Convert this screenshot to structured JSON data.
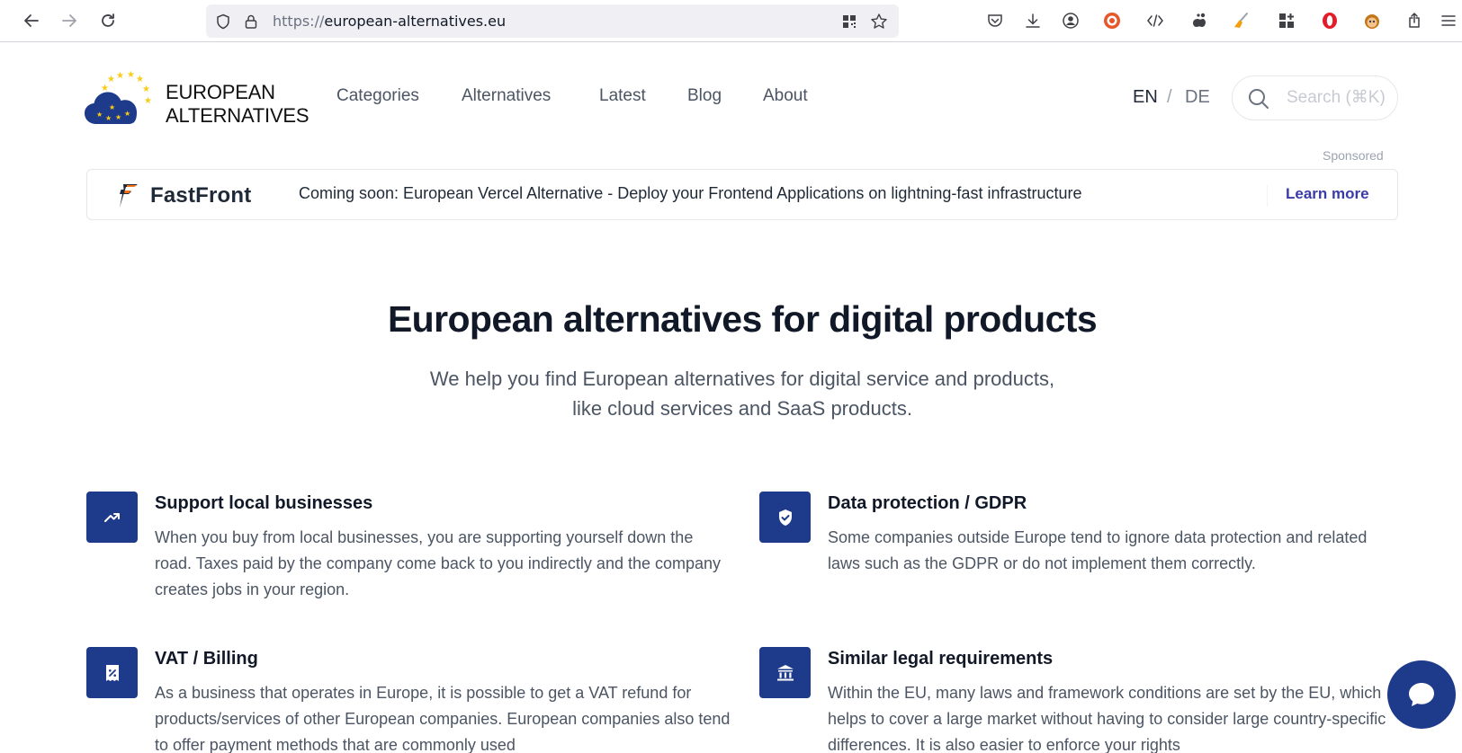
{
  "browser": {
    "url_scheme": "https://",
    "url_host": "european-alternatives.eu"
  },
  "site": {
    "logo_line1": "EUROPEAN",
    "logo_line2": "ALTERNATIVES",
    "nav": [
      "Categories",
      "Alternatives",
      "Latest",
      "Blog",
      "About"
    ],
    "lang_en": "EN",
    "lang_sep": "/",
    "lang_de": "DE",
    "search_placeholder": "Search (⌘K)"
  },
  "sponsor": {
    "label": "Sponsored",
    "brand": "FastFront",
    "text": "Coming soon: European Vercel Alternative - Deploy your Frontend Applications on lightning-fast infrastructure",
    "cta": "Learn more"
  },
  "hero": {
    "title": "European alternatives for digital products",
    "subtitle_line1": "We help you find European alternatives for digital service and products,",
    "subtitle_line2": "like cloud services and SaaS products."
  },
  "features": [
    {
      "icon": "trending-up-icon",
      "title": "Support local businesses",
      "body": "When you buy from local businesses, you are supporting yourself down the road. Taxes paid by the company come back to you indirectly and the company creates jobs in your region."
    },
    {
      "icon": "shield-check-icon",
      "title": "Data protection / GDPR",
      "body": "Some companies outside Europe tend to ignore data protection and related laws such as the GDPR or do not implement them correctly."
    },
    {
      "icon": "receipt-percent-icon",
      "title": "VAT / Billing",
      "body": "As a business that operates in Europe, it is possible to get a VAT refund for products/services of other European companies. European companies also tend to offer payment methods that are commonly used"
    },
    {
      "icon": "building-library-icon",
      "title": "Similar legal requirements",
      "body": "Within the EU, many laws and framework conditions are set by the EU, which helps to cover a large market without having to consider large country-specific differences. It is also easier to enforce your rights"
    }
  ],
  "colors": {
    "accent": "#1e3a8a",
    "cta": "#3b3ba8",
    "star": "#facc15"
  }
}
